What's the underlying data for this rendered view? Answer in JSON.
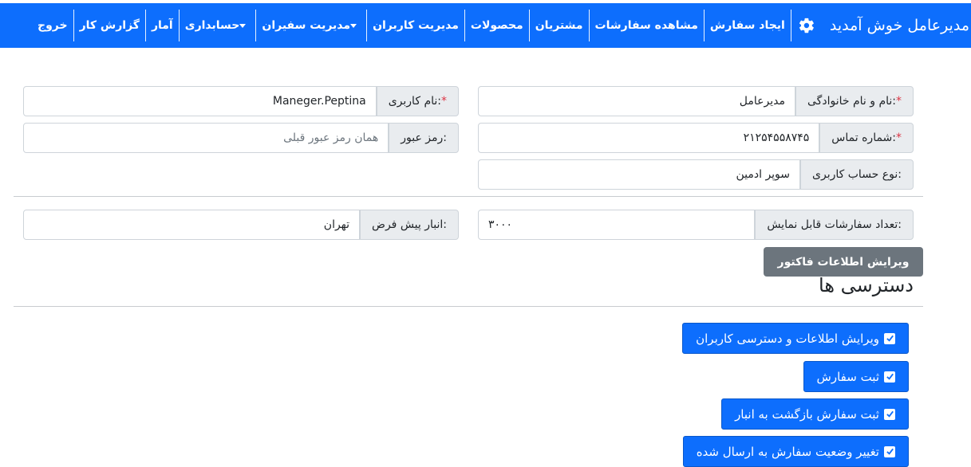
{
  "nav": {
    "brand": "مدیرعامل خوش آمدید",
    "items": [
      {
        "label": "ایجاد سفارش",
        "dropdown": false
      },
      {
        "label": "مشاهده سفارشات",
        "dropdown": false
      },
      {
        "label": "مشتریان",
        "dropdown": false
      },
      {
        "label": "محصولات",
        "dropdown": false
      },
      {
        "label": "مدیریت کاربران",
        "dropdown": false
      },
      {
        "label": "مدیریت سفیران",
        "dropdown": true
      },
      {
        "label": "حسابداری",
        "dropdown": true
      },
      {
        "label": "آمار",
        "dropdown": false
      },
      {
        "label": "گزارش کار",
        "dropdown": false
      },
      {
        "label": "خروج",
        "dropdown": false
      }
    ]
  },
  "form": {
    "fullname_label": "نام و نام خانوادگی:",
    "fullname_value": "مدیرعامل",
    "username_label": "نام کاربری:",
    "username_value": "Maneger.Peptina",
    "phone_label": "شماره تماس:",
    "phone_value": "۲۱۲۵۴۵۵۸۷۴۵",
    "password_label": "رمز عبور:",
    "password_placeholder": "همان رمز عبور قبلی",
    "account_type_label": "نوع حساب کاربری:",
    "account_type_value": "سوپر ادمین",
    "orders_count_label": "تعداد سفارشات قابل نمایش:",
    "orders_count_value": "۳۰۰۰",
    "warehouse_label": "انبار پیش فرض:",
    "warehouse_value": "تهران",
    "required_mark": "*"
  },
  "invoice_button": "ویرایش اطلاعات فاکتور",
  "permissions": {
    "heading": "دسترسی ها",
    "items": [
      {
        "label": "ویرایش اطلاعات و دسترسی کاربران",
        "checked": true
      },
      {
        "label": "ثبت سفارش",
        "checked": true
      },
      {
        "label": "ثبت سفارش بازگشت به انبار",
        "checked": true
      },
      {
        "label": "تغییر وضعیت سفارش به ارسال شده",
        "checked": true
      }
    ]
  },
  "colors": {
    "primary": "#0d6efd",
    "secondary": "#6c757d",
    "required": "#dc3545"
  }
}
